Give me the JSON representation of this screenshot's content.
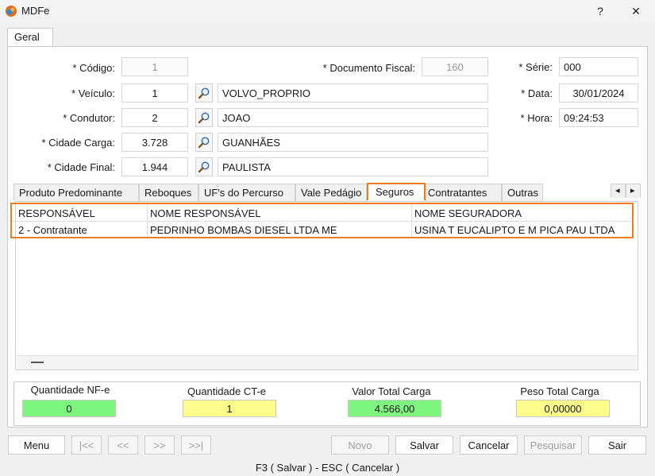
{
  "window": {
    "title": "MDFe",
    "help": "?",
    "close": "✕"
  },
  "tabs": {
    "geral": "Geral"
  },
  "labels": {
    "codigo": "* Código:",
    "veiculo": "* Veículo:",
    "condutor": "* Condutor:",
    "cidade_carga": "* Cidade Carga:",
    "cidade_final": "* Cidade Final:",
    "documento_fiscal": "* Documento Fiscal:",
    "serie": "* Série:",
    "data": "* Data:",
    "hora": "* Hora:"
  },
  "values": {
    "codigo": "1",
    "veiculo_codigo": "1",
    "veiculo_nome": "VOLVO_PROPRIO",
    "condutor_codigo": "2",
    "condutor_nome": "JOAO",
    "cidade_carga_codigo": "3.728",
    "cidade_carga_nome": "GUANHÃES",
    "cidade_final_codigo": "1.944",
    "cidade_final_nome": "PAULISTA",
    "documento_fiscal": "160",
    "serie": "000",
    "data": "30/01/2024",
    "hora": "09:24:53"
  },
  "subtabs": [
    "Produto Predominante",
    "Reboques",
    "UF's do Percurso",
    "Vale Pedágio",
    "Seguros",
    "Contratantes",
    "Outras"
  ],
  "subtab_scroll": {
    "left": "◂",
    "right": "▸"
  },
  "seguros_table": {
    "headers": [
      "RESPONSÁVEL",
      "NOME RESPONSÁVEL",
      "NOME SEGURADORA"
    ],
    "rows": [
      [
        "2 - Contratante",
        "PEDRINHO BOMBAS DIESEL LTDA ME",
        "USINA T EUCALIPTO E M PICA PAU LTDA"
      ]
    ]
  },
  "totals": {
    "qtd_nfe_label": "Quantidade NF-e",
    "qtd_nfe": "0",
    "qtd_cte_label": "Quantidade CT-e",
    "qtd_cte": "1",
    "valor_total_label": "Valor Total Carga",
    "valor_total": "4.566,00",
    "peso_total_label": "Peso Total Carga",
    "peso_total": "0,00000"
  },
  "buttons": {
    "menu": "Menu",
    "first": "|<<",
    "prev": "<<",
    "next": ">>",
    "last": ">>|",
    "novo": "Novo",
    "salvar": "Salvar",
    "cancelar": "Cancelar",
    "pesquisar": "Pesquisar",
    "sair": "Sair"
  },
  "status": "F3 ( Salvar )  -  ESC ( Cancelar )",
  "colors": {
    "accent": "#f07c20",
    "green": "#7ef57e",
    "yellow": "#fcfc8a"
  },
  "icons": {
    "app": "mdfe-app-icon",
    "search": "magnifier-icon"
  }
}
